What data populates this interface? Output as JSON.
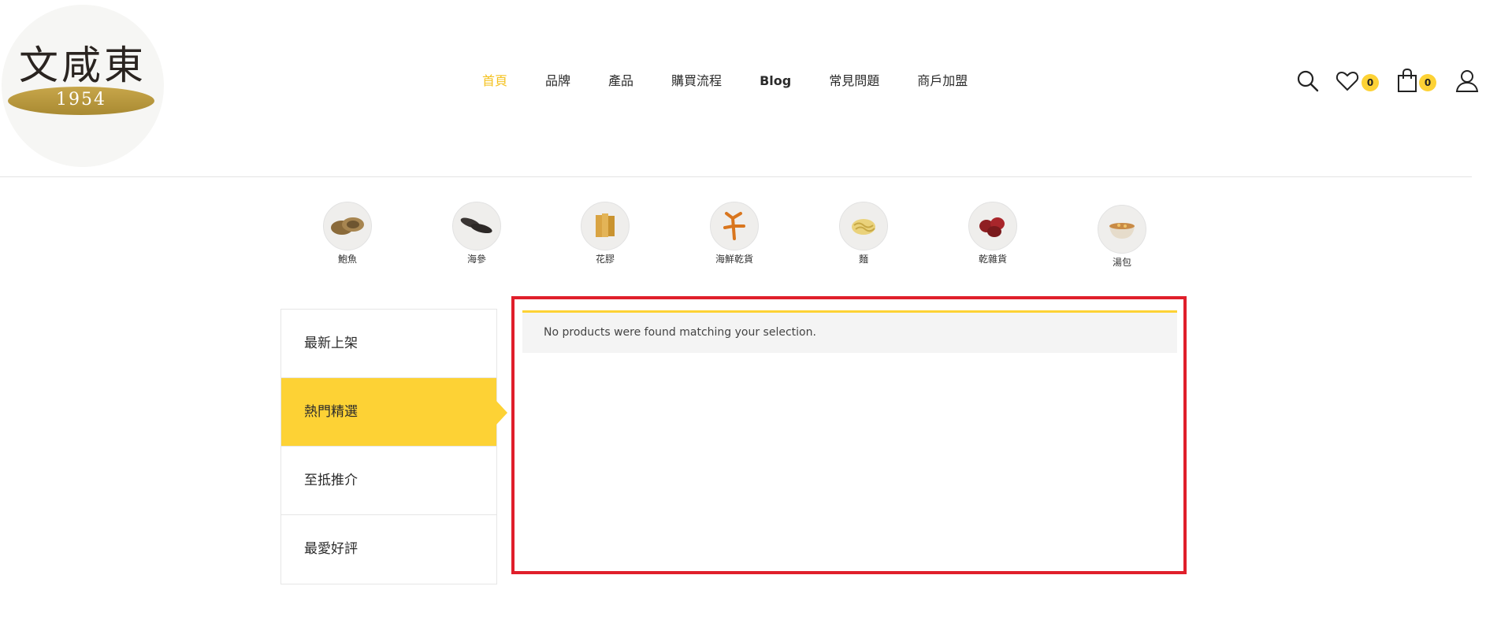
{
  "brand": {
    "logo_text": "文咸東",
    "logo_year": "1954"
  },
  "nav": [
    "首頁",
    "品牌",
    "產品",
    "購買流程",
    "Blog",
    "常見問題",
    "商戶加盟"
  ],
  "header_icons": {
    "search": "search-icon",
    "wishlist": "heart-icon",
    "wishlist_count": "0",
    "cart": "shopping-bag-icon",
    "cart_count": "0",
    "account": "user-icon"
  },
  "categories": [
    "鮑魚",
    "海參",
    "花膠",
    "海鮮乾貨",
    "麵",
    "乾雜貨",
    "湯包"
  ],
  "tabs": [
    "最新上架",
    "熱門精選",
    "至抵推介",
    "最愛好評"
  ],
  "active_tab": "熱門精選",
  "notice": "No products were found matching your selection.",
  "colors": {
    "accent": "#fdd235",
    "highlight_border": "#e01f2b",
    "active_nav": "#f4c220"
  }
}
